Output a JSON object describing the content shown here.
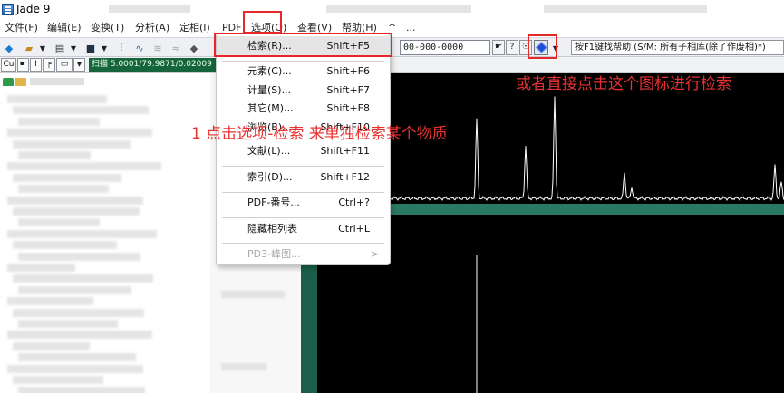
{
  "window": {
    "title": "Jade 9"
  },
  "menubar": {
    "items": [
      "文件(F)",
      "编辑(E)",
      "变换(T)",
      "分析(A)",
      "定相(I)",
      "PDF",
      "选项(O)",
      "查看(V)",
      "帮助(H)",
      "^",
      "..."
    ]
  },
  "toolbar": {
    "phase_field": "00-000-0000",
    "help_field": "按F1键找帮助 (S/M: 所有子相库(除了作废相)*)",
    "small_buttons": [
      "☛",
      "?",
      "☉"
    ]
  },
  "bar2": {
    "element_box": "Cu",
    "scan_label": "扫描 5.0001/79.9871/0.02009"
  },
  "dropdown": {
    "items": [
      {
        "label": "检索(R)...",
        "shortcut": "Shift+F5"
      },
      {
        "label": "元素(C)...",
        "shortcut": "Shift+F6"
      },
      {
        "label": "计量(S)...",
        "shortcut": "Shift+F7"
      },
      {
        "label": "其它(M)...",
        "shortcut": "Shift+F8"
      },
      {
        "label": "浏览(B)...",
        "shortcut": "Shift+F10"
      },
      {
        "label": "文献(L)...",
        "shortcut": "Shift+F11"
      },
      {
        "label": "索引(D)...",
        "shortcut": "Shift+F12"
      },
      {
        "label": "PDF-番号...",
        "shortcut": "Ctrl+?"
      },
      {
        "label": "隐藏相列表",
        "shortcut": "Ctrl+L"
      },
      {
        "label": "PD3-峰图...",
        "shortcut": ">"
      }
    ]
  },
  "annotations": {
    "left_note": "1 点击选项-检索 来单独检索某个物质",
    "right_note": "或者直接点击这个图标进行检索"
  },
  "colors": {
    "annotation_red": "#e52727",
    "plot_background": "#000000",
    "plot_frame": "#1e6a52"
  }
}
